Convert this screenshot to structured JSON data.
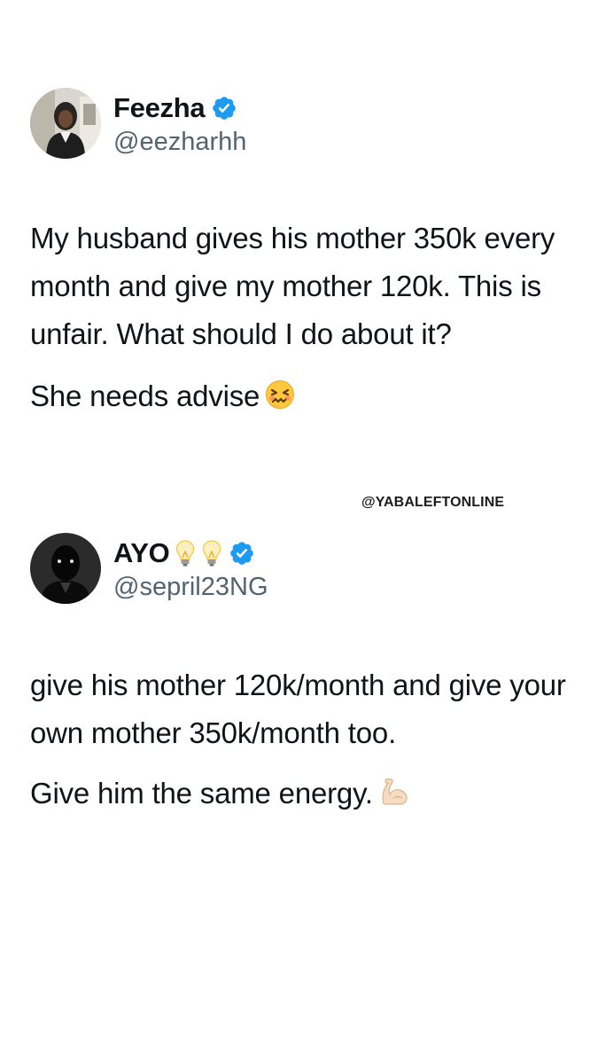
{
  "tweets": [
    {
      "name": "Feezha",
      "handle": "@eezharhh",
      "verified": true,
      "paragraphs": [
        "My husband gives his mother 350k every month and give my mother 120k. This is unfair. What should I do about it?",
        "She needs advise"
      ],
      "emoji": "confounded-face-icon"
    },
    {
      "name": "AYO",
      "handle": "@sepril23NG",
      "verified": true,
      "name_emojis": [
        "light-bulb-icon",
        "light-bulb-icon"
      ],
      "paragraphs": [
        "give his mother 120k/month and give your own mother 350k/month too.",
        "Give him the same energy."
      ],
      "emoji": "flexed-biceps-icon"
    }
  ],
  "watermark": "@YABALEFTONLINE",
  "colors": {
    "verified": "#1d9bf0",
    "text": "#0f1419",
    "handle": "#536471",
    "background": "#ffffff"
  }
}
